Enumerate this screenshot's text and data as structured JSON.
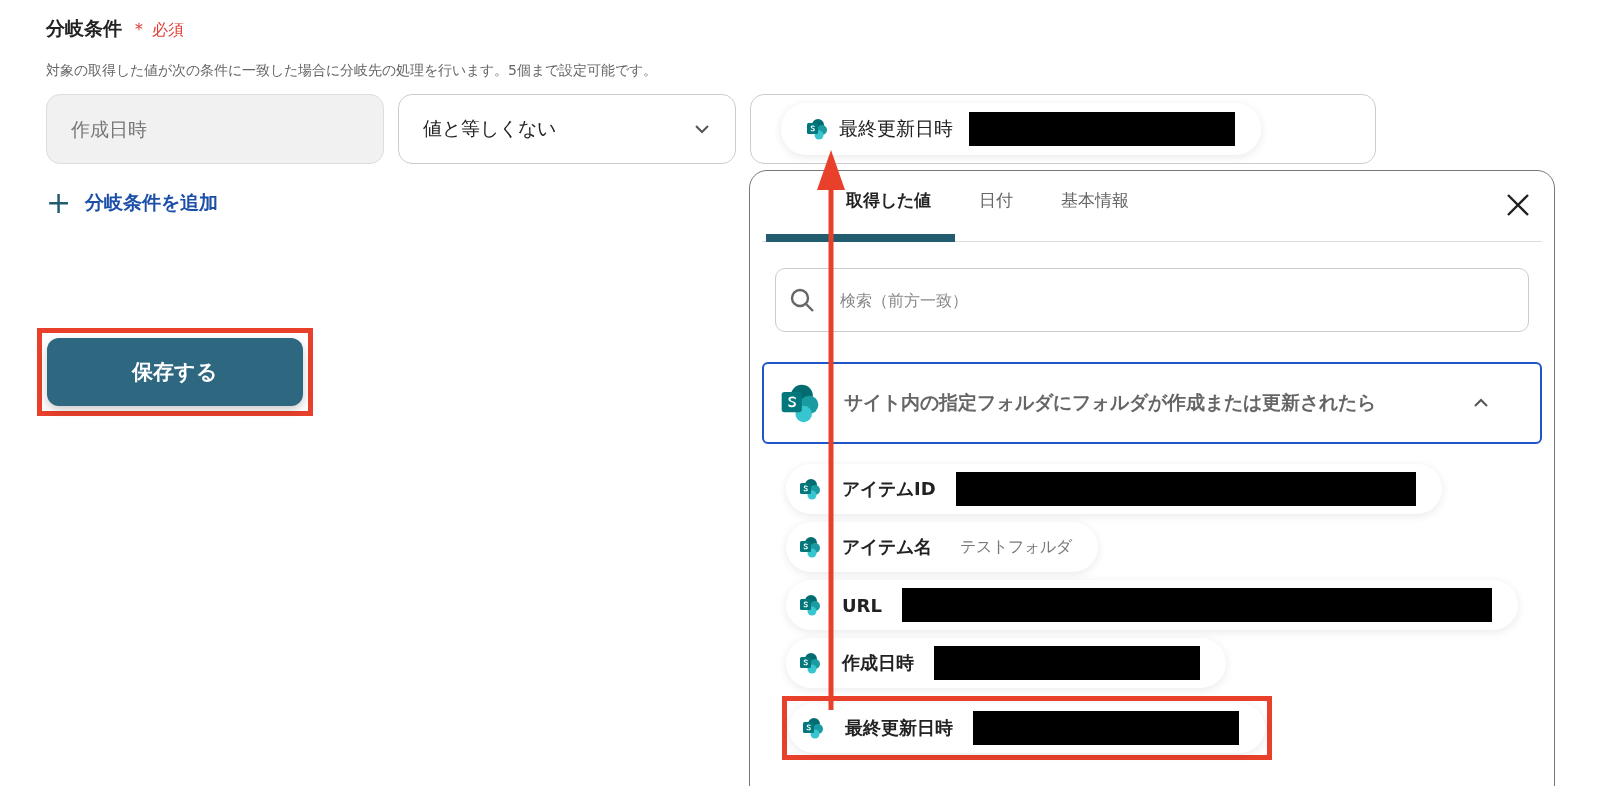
{
  "section": {
    "title": "分岐条件",
    "required_mark": "＊",
    "required_label": "必須",
    "description": "対象の取得した値が次の条件に一致した場合に分岐先の処理を行います。5個まで設定可能です。"
  },
  "condition": {
    "field": {
      "placeholder": "作成日時"
    },
    "operator": {
      "value": "値と等しくない"
    },
    "value_chip": {
      "label": "最終更新日時",
      "redacted": true
    }
  },
  "add_condition": {
    "icon": "+",
    "label": "分岐条件を追加"
  },
  "save_button": {
    "label": "保存する"
  },
  "picker": {
    "tabs": [
      {
        "label": "取得した値",
        "selected": true
      },
      {
        "label": "日付",
        "selected": false
      },
      {
        "label": "基本情報",
        "selected": false
      }
    ],
    "search": {
      "placeholder": "検索（前方一致）"
    },
    "group": {
      "title": "サイト内の指定フォルダにフォルダが作成または更新されたら",
      "expanded": true
    },
    "items": [
      {
        "label": "アイテムID",
        "redacted": true
      },
      {
        "label": "アイテム名",
        "value": "テストフォルダ",
        "redacted": false
      },
      {
        "label": "URL",
        "redacted": true
      },
      {
        "label": "作成日時",
        "redacted": true
      },
      {
        "label": "最終更新日時",
        "redacted": true
      }
    ]
  }
}
